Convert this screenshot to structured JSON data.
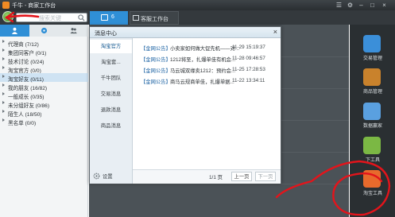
{
  "window": {
    "title": "千牛 - 商家工作台"
  },
  "search": {
    "placeholder": "搜索关键"
  },
  "tabs": [
    {
      "label": "6",
      "active": true
    },
    {
      "label": "客服工作台",
      "active": false
    }
  ],
  "contact_groups": [
    {
      "label": "代理商 (7/12)"
    },
    {
      "label": "集团同客户 (0/1)"
    },
    {
      "label": "技术讨论 (0/24)"
    },
    {
      "label": "淘宝官方 (0/0)"
    },
    {
      "label": "淘宝好友 (0/11)",
      "selected": true
    },
    {
      "label": "我的朋友 (16/82)"
    },
    {
      "label": "一般成长 (0/35)"
    },
    {
      "label": "未分组好友 (0/86)"
    },
    {
      "label": "陌生人 (18/50)"
    },
    {
      "label": "黑名单 (0/0)"
    }
  ],
  "dialog": {
    "title": "消息中心",
    "close": "×",
    "nav": [
      {
        "label": "淘宝官方",
        "active": true
      },
      {
        "label": "淘宝套..."
      },
      {
        "label": "千牛团队"
      },
      {
        "label": "交易消息"
      },
      {
        "label": "退款消息"
      },
      {
        "label": "商品消息"
      }
    ],
    "messages": [
      {
        "source": "【金网公告】",
        "text": "小卖家如何做大促先机——对...",
        "time": "11-29 15:19:37"
      },
      {
        "source": "【金网公告】",
        "text": "1212将至，扎爆单佳有机会...",
        "time": "11-28 09:46:57"
      },
      {
        "source": "【金网公告】",
        "text": "马云城双缘卖1212：预约会...",
        "time": "11-25 17:28:53"
      },
      {
        "source": "【金网公告】",
        "text": "商马云规商单佳，扎爆单据...",
        "time": "11-22 13:34:11"
      }
    ],
    "footer": {
      "settings": "设置",
      "page": "1/1 页",
      "prev": "上一页",
      "next": "下一页"
    }
  },
  "dock": [
    {
      "label": "交易管理",
      "color": "#3b8fd9"
    },
    {
      "label": "商品管理",
      "color": "#c9822c"
    },
    {
      "label": "数据赢家",
      "color": "#5aa0e0"
    },
    {
      "label": "下工具",
      "color": "#7bb844"
    },
    {
      "label": "淘宝工具",
      "color": "#e86a2c"
    }
  ],
  "colors": {
    "accent": "#2f8fd6",
    "annotation_red": "#e3141b"
  }
}
